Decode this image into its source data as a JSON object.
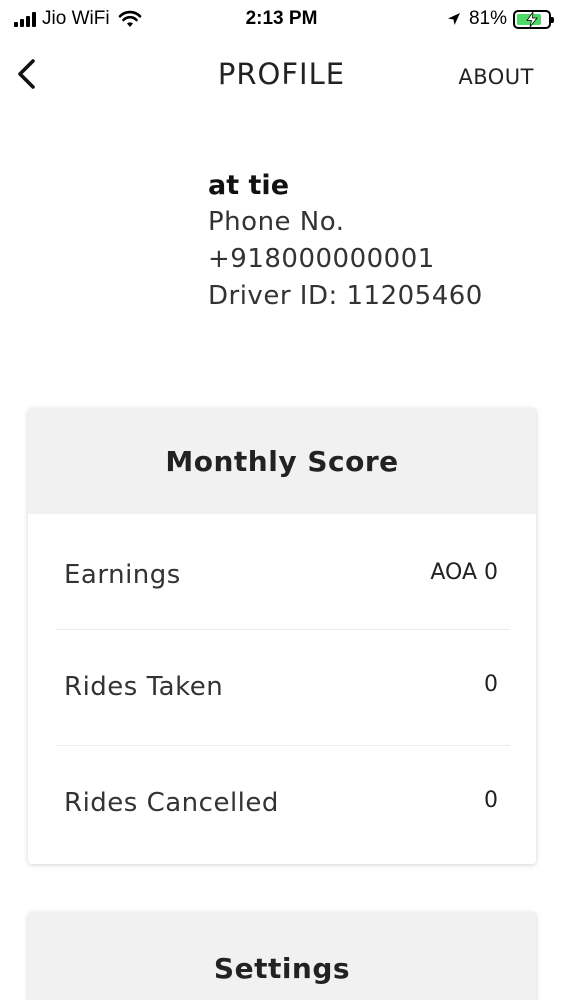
{
  "status_bar": {
    "carrier": "Jio WiFi",
    "time": "2:13 PM",
    "battery_percent_label": "81%",
    "battery_level": 0.81,
    "battery_color": "#4cd964"
  },
  "nav": {
    "back_icon": "chevron-left-icon",
    "title": "PROFILE",
    "about_label": "ABOUT"
  },
  "profile": {
    "name": "at tie",
    "phone_label": "Phone No.",
    "phone": "+918000000001",
    "driver_id": "Driver ID: 11205460"
  },
  "monthly_score": {
    "title": "Monthly Score",
    "rows": [
      {
        "label": "Earnings",
        "value": "AOA 0"
      },
      {
        "label": "Rides Taken",
        "value": "0"
      },
      {
        "label": "Rides Cancelled",
        "value": "0"
      }
    ]
  },
  "settings": {
    "title": "Settings"
  }
}
